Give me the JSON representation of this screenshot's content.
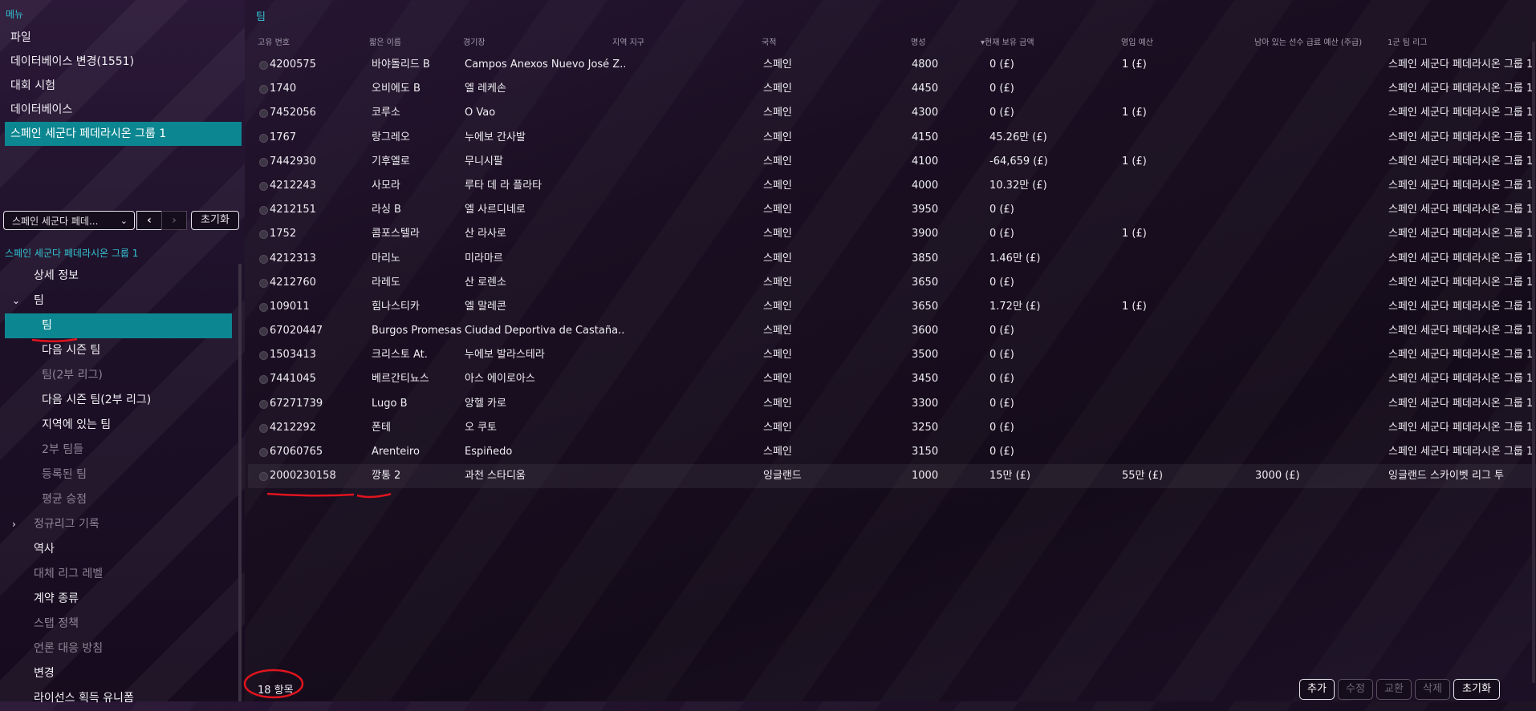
{
  "left": {
    "menu_title": "메뉴",
    "menu_items": [
      "파일",
      "데이터베이스 변경(1551)",
      "대회 시험",
      "데이터베이스",
      "스페인 세군다 페데라시온 그룹 1"
    ],
    "dropdown_label": "스페인 세군다 페데...",
    "prev_label": "‹",
    "next_label": "›",
    "reset_label": "초기화",
    "tree_title": "스페인 세군다 페데라시온 그룹 1",
    "tree": [
      {
        "label": "상세 정보"
      },
      {
        "label": "팀"
      },
      {
        "label": "팀"
      },
      {
        "label": "다음 시즌 팀"
      },
      {
        "label": "팀(2부 리그)"
      },
      {
        "label": "다음 시즌 팀(2부 리그)"
      },
      {
        "label": "지역에 있는 팀"
      },
      {
        "label": "2부 팀들"
      },
      {
        "label": "등록된 팀"
      },
      {
        "label": "평균 승점"
      },
      {
        "label": "정규리그 기록"
      },
      {
        "label": "역사"
      },
      {
        "label": "대체 리그 레벨"
      },
      {
        "label": "계약 종류"
      },
      {
        "label": "스탭 정책"
      },
      {
        "label": "언론 대응 방침"
      },
      {
        "label": "변경"
      },
      {
        "label": "라이선스 획득 유니폼"
      }
    ]
  },
  "right": {
    "title": "팀",
    "headers": {
      "id": "고유 번호",
      "short": "짧은 이름",
      "stadium": "경기장",
      "region": "지역 지구",
      "nation": "국적",
      "rep": "명성",
      "balance": "▾현재 보유 금액",
      "transfer": "영입 예산",
      "wage": "남아 있는 선수 급료 예산 (주급)",
      "league": "1군 팀 리그"
    },
    "rows": [
      {
        "id": "4200575",
        "short": "바야돌리드 B",
        "stadium": "Campos Anexos Nuevo José Z...",
        "nation": "스페인",
        "rep": "4800",
        "balance": "0 (£)",
        "transfer": "1 (£)",
        "wage": "",
        "league": "스페인 세군다 페데라시온 그룹 1"
      },
      {
        "id": "1740",
        "short": "오비에도 B",
        "stadium": "엘 레케손",
        "nation": "스페인",
        "rep": "4450",
        "balance": "0 (£)",
        "transfer": "",
        "wage": "",
        "league": "스페인 세군다 페데라시온 그룹 1"
      },
      {
        "id": "7452056",
        "short": "코루소",
        "stadium": "O Vao",
        "nation": "스페인",
        "rep": "4300",
        "balance": "0 (£)",
        "transfer": "1 (£)",
        "wage": "",
        "league": "스페인 세군다 페데라시온 그룹 1"
      },
      {
        "id": "1767",
        "short": "랑그레오",
        "stadium": "누에보 간사발",
        "nation": "스페인",
        "rep": "4150",
        "balance": "45.26만 (£)",
        "transfer": "",
        "wage": "",
        "league": "스페인 세군다 페데라시온 그룹 1"
      },
      {
        "id": "7442930",
        "short": "기후엘로",
        "stadium": "무니시팔",
        "nation": "스페인",
        "rep": "4100",
        "balance": "-64,659 (£)",
        "transfer": "1 (£)",
        "wage": "",
        "league": "스페인 세군다 페데라시온 그룹 1"
      },
      {
        "id": "4212243",
        "short": "사모라",
        "stadium": "루타 데 라 플라타",
        "nation": "스페인",
        "rep": "4000",
        "balance": "10.32만 (£)",
        "transfer": "",
        "wage": "",
        "league": "스페인 세군다 페데라시온 그룹 1"
      },
      {
        "id": "4212151",
        "short": "라싱 B",
        "stadium": "엘 사르디네로",
        "nation": "스페인",
        "rep": "3950",
        "balance": "0 (£)",
        "transfer": "",
        "wage": "",
        "league": "스페인 세군다 페데라시온 그룹 1"
      },
      {
        "id": "1752",
        "short": "콤포스텔라",
        "stadium": "산 라사로",
        "nation": "스페인",
        "rep": "3900",
        "balance": "0 (£)",
        "transfer": "1 (£)",
        "wage": "",
        "league": "스페인 세군다 페데라시온 그룹 1"
      },
      {
        "id": "4212313",
        "short": "마리노",
        "stadium": "미라마르",
        "nation": "스페인",
        "rep": "3850",
        "balance": "1.46만 (£)",
        "transfer": "",
        "wage": "",
        "league": "스페인 세군다 페데라시온 그룹 1"
      },
      {
        "id": "4212760",
        "short": "라레도",
        "stadium": "산 로렌소",
        "nation": "스페인",
        "rep": "3650",
        "balance": "0 (£)",
        "transfer": "",
        "wage": "",
        "league": "스페인 세군다 페데라시온 그룹 1"
      },
      {
        "id": "109011",
        "short": "힘나스티카",
        "stadium": "엘 말레콘",
        "nation": "스페인",
        "rep": "3650",
        "balance": "1.72만 (£)",
        "transfer": "1 (£)",
        "wage": "",
        "league": "스페인 세군다 페데라시온 그룹 1"
      },
      {
        "id": "67020447",
        "short": "Burgos Promesas",
        "stadium": "Ciudad Deportiva de Castaña...",
        "nation": "스페인",
        "rep": "3600",
        "balance": "0 (£)",
        "transfer": "",
        "wage": "",
        "league": "스페인 세군다 페데라시온 그룹 1"
      },
      {
        "id": "1503413",
        "short": "크리스토 At.",
        "stadium": "누에보 발라스테라",
        "nation": "스페인",
        "rep": "3500",
        "balance": "0 (£)",
        "transfer": "",
        "wage": "",
        "league": "스페인 세군다 페데라시온 그룹 1"
      },
      {
        "id": "7441045",
        "short": "베르간티뇨스",
        "stadium": "아스 에이로아스",
        "nation": "스페인",
        "rep": "3450",
        "balance": "0 (£)",
        "transfer": "",
        "wage": "",
        "league": "스페인 세군다 페데라시온 그룹 1"
      },
      {
        "id": "67271739",
        "short": "Lugo B",
        "stadium": "앙헬 카로",
        "nation": "스페인",
        "rep": "3300",
        "balance": "0 (£)",
        "transfer": "",
        "wage": "",
        "league": "스페인 세군다 페데라시온 그룹 1"
      },
      {
        "id": "4212292",
        "short": "폰테",
        "stadium": "오 쿠토",
        "nation": "스페인",
        "rep": "3250",
        "balance": "0 (£)",
        "transfer": "",
        "wage": "",
        "league": "스페인 세군다 페데라시온 그룹 1"
      },
      {
        "id": "67060765",
        "short": "Arenteiro",
        "stadium": "Espiñedo",
        "nation": "스페인",
        "rep": "3150",
        "balance": "0 (£)",
        "transfer": "",
        "wage": "",
        "league": "스페인 세군다 페데라시온 그룹 1"
      },
      {
        "id": "2000230158",
        "short": "깡통   2",
        "stadium": "과천 스타디움",
        "nation": "잉글랜드",
        "rep": "1000",
        "balance": "15만 (£)",
        "transfer": "55만 (£)",
        "wage": "3000 (£)",
        "league": "잉글랜드 스카이벳 리그 투"
      }
    ],
    "count_label": "18 항목",
    "buttons": [
      "추가",
      "수정",
      "교환",
      "삭제",
      "초기화"
    ]
  },
  "colors": {
    "accent": "#0c8791",
    "title_cyan": "#33c3d4",
    "annotation_red": "#e0141e"
  }
}
